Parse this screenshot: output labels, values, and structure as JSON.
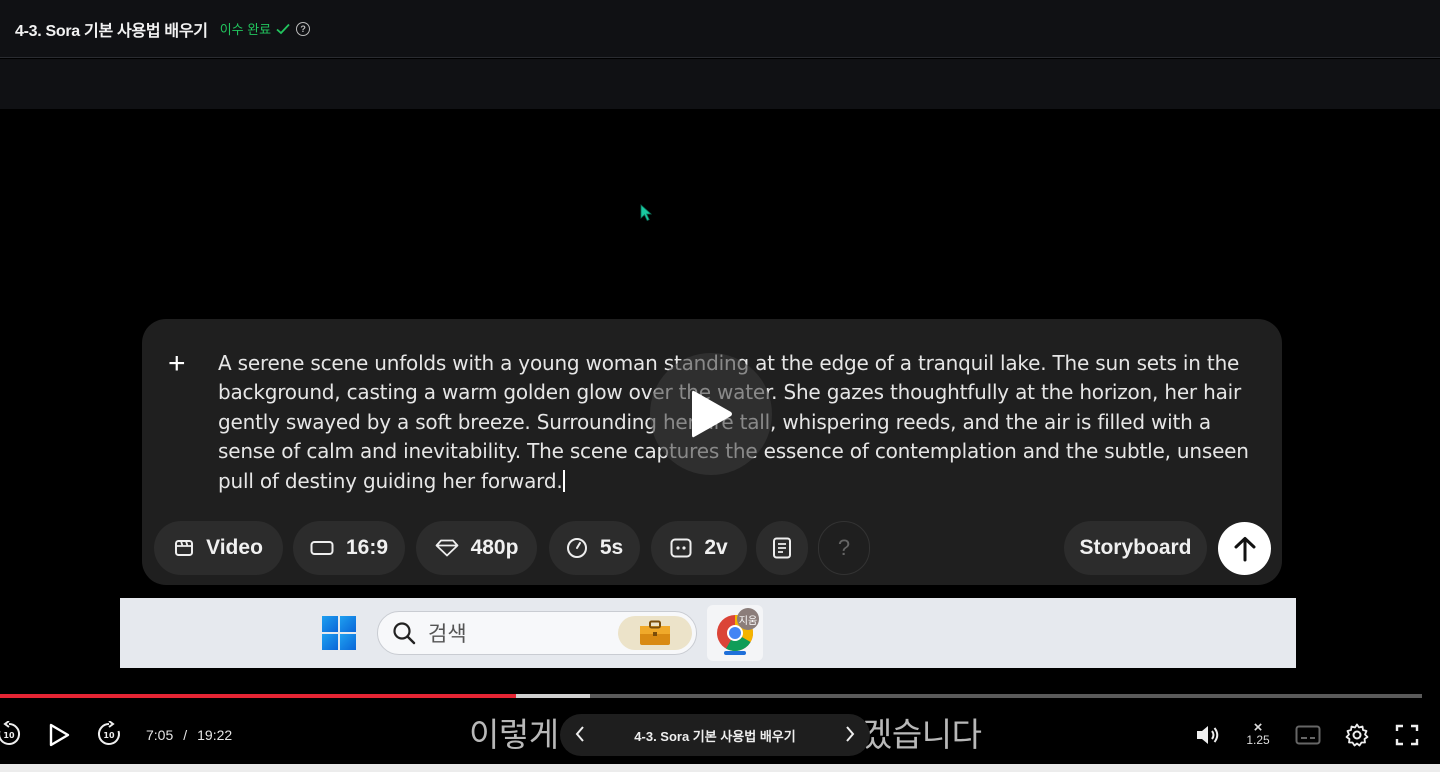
{
  "header": {
    "title": "4-3. Sora 기본 사용법 배우기",
    "status": "이수 완료",
    "check_icon": "check-icon",
    "help_icon": "help-circle-icon",
    "status_color": "#22c55e"
  },
  "prompt": {
    "plus_label": "+",
    "text": "A serene scene unfolds with a young woman standing at the edge of a tranquil lake. The sun sets in the background, casting a warm golden glow over the water. She gazes thoughtfully at the horizon, her hair gently swayed by a soft breeze. Surrounding her are tall, whispering reeds, and the air is filled with a sense of calm and inevitability. The scene captures the essence of contemplation and the subtle, unseen pull of destiny guiding her forward."
  },
  "toolbar": {
    "video_label": "Video",
    "ratio_label": "16:9",
    "resolution_label": "480p",
    "duration_label": "5s",
    "variations_label": "2v",
    "help_label": "?",
    "storyboard_label": "Storyboard"
  },
  "taskbar": {
    "search_placeholder": "검색",
    "chrome_badge": "지움"
  },
  "player": {
    "current_time": "7:05",
    "separator": "/",
    "duration": "19:22",
    "progress_fraction": 0.363,
    "buffer_fraction": 0.415,
    "subtitle": "이렇게 붙여 넣기 해주도록 하겠습니다",
    "chapter_title": "4-3. Sora 기본 사용법 배우기",
    "speed_symbol": "×",
    "speed_value": "1.25",
    "accent_color": "#e52534"
  }
}
